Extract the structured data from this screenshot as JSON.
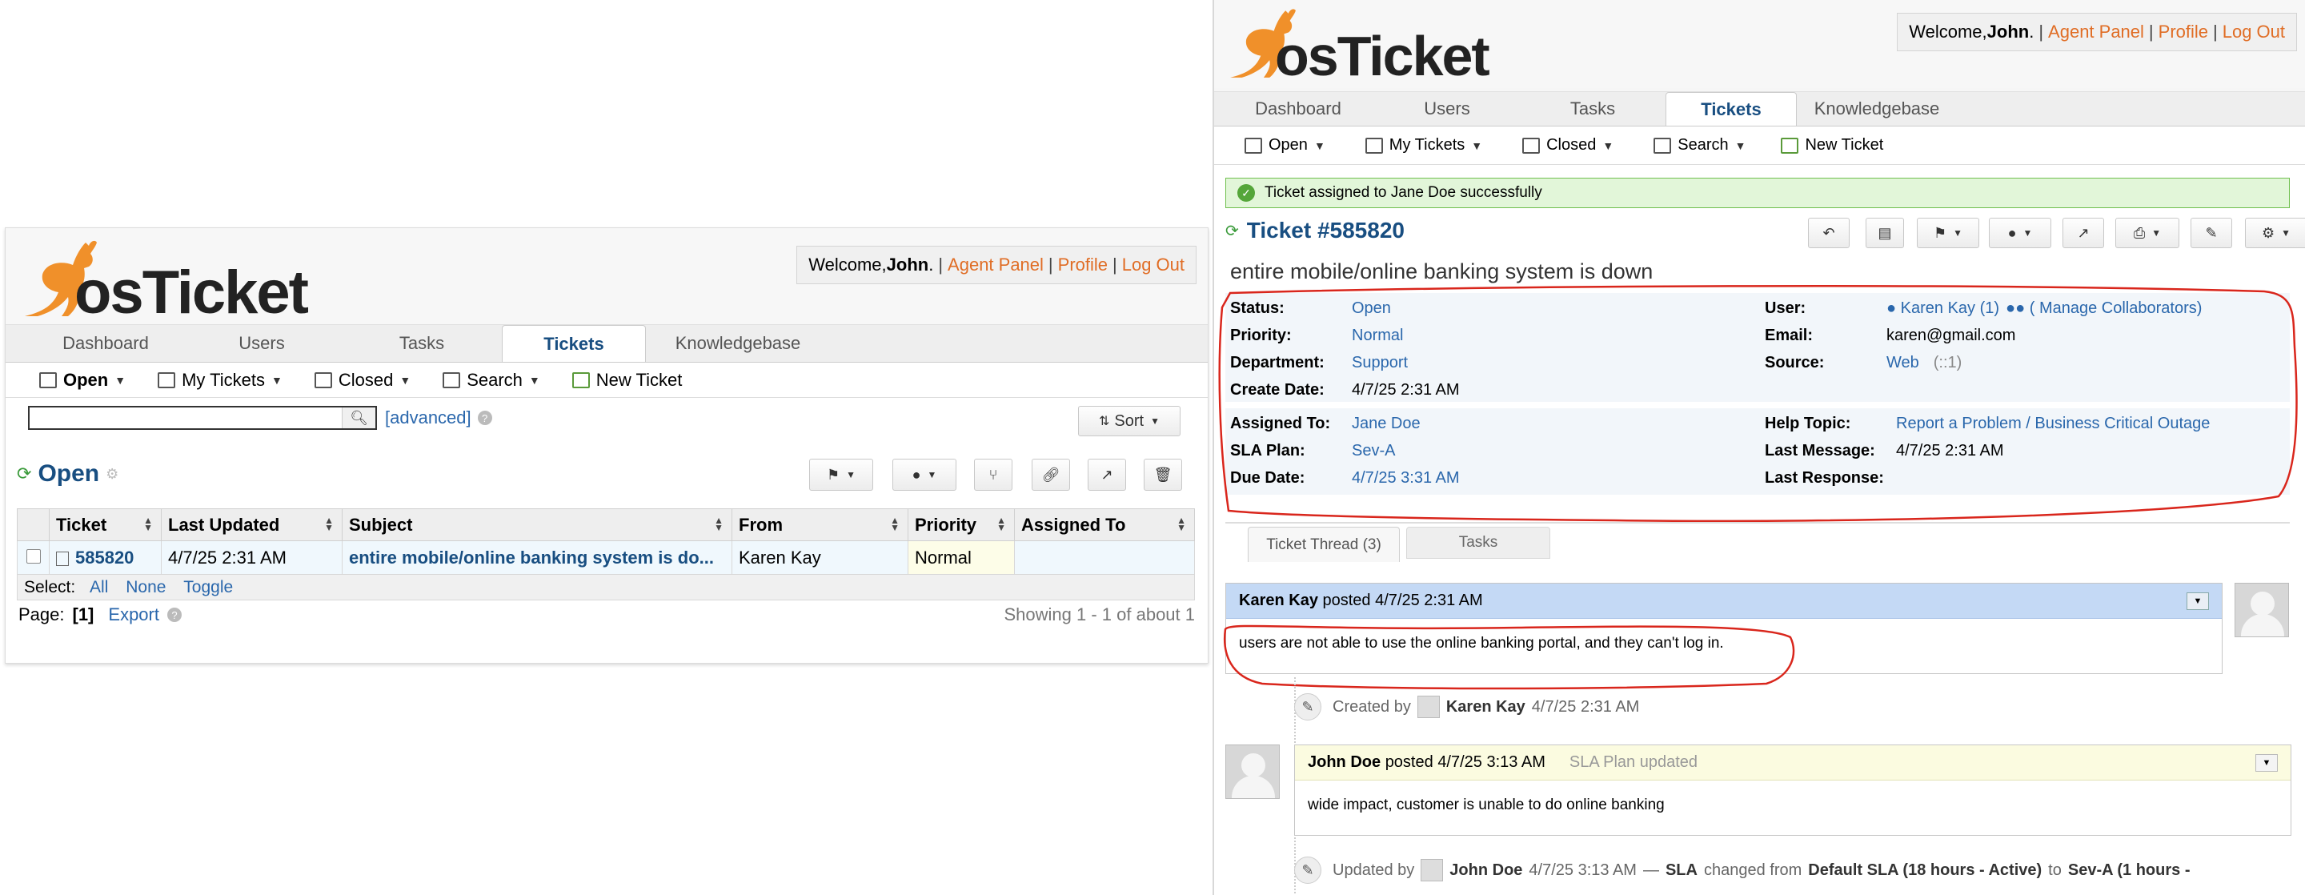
{
  "welcome": {
    "prefix": "Welcome, ",
    "user": "John",
    "suffix": ".",
    "agent_panel": "Agent Panel",
    "profile": "Profile",
    "logout": "Log Out"
  },
  "logo": {
    "text": "osTicket"
  },
  "nav": {
    "tabs": [
      "Dashboard",
      "Users",
      "Tasks",
      "Tickets",
      "Knowledgebase"
    ],
    "active": "Tickets"
  },
  "subnav": {
    "open": "Open",
    "my_tickets": "My Tickets",
    "closed": "Closed",
    "search": "Search",
    "new_ticket": "New Ticket"
  },
  "left": {
    "search_value": "",
    "advanced": "[advanced]",
    "sort": "Sort",
    "queue_title": "Open",
    "columns": [
      "Ticket",
      "Last Updated",
      "Subject",
      "From",
      "Priority",
      "Assigned To"
    ],
    "rows": [
      {
        "ticket": "585820",
        "last_updated": "4/7/25 2:31 AM",
        "subject": "entire mobile/online banking system is do...",
        "from": "Karen Kay",
        "priority": "Normal",
        "assigned_to": ""
      }
    ],
    "select_label": "Select:",
    "select_all": "All",
    "select_none": "None",
    "select_toggle": "Toggle",
    "page_label": "Page:",
    "page_value": "[1]",
    "export": "Export",
    "showing": "Showing 1 - 1 of about 1"
  },
  "right": {
    "alert": "Ticket assigned to Jane Doe successfully",
    "ticket_title": "Ticket #585820",
    "subject": "entire mobile/online banking system is down",
    "info_left_1": [
      {
        "label": "Status:",
        "value": "Open",
        "link": true
      },
      {
        "label": "Priority:",
        "value": "Normal",
        "link": true
      },
      {
        "label": "Department:",
        "value": "Support",
        "link": true
      },
      {
        "label": "Create Date:",
        "value": "4/7/25 2:31 AM",
        "link": false
      }
    ],
    "info_right_1": [
      {
        "label": "User:",
        "value": "Karen Kay (1)",
        "extra": "( Manage Collaborators)"
      },
      {
        "label": "Email:",
        "value": "karen@gmail.com"
      },
      {
        "label": "Source:",
        "value": "Web",
        "extra": "(::1)"
      }
    ],
    "info_left_2": [
      {
        "label": "Assigned To:",
        "value": "Jane Doe",
        "link": true
      },
      {
        "label": "SLA Plan:",
        "value": "Sev-A",
        "link": true
      },
      {
        "label": "Due Date:",
        "value": "4/7/25 3:31 AM",
        "link": true
      }
    ],
    "info_right_2": [
      {
        "label": "Help Topic:",
        "value": "Report a Problem / Business Critical Outage",
        "link": true
      },
      {
        "label": "Last Message:",
        "value": "4/7/25 2:31 AM",
        "link": false
      },
      {
        "label": "Last Response:",
        "value": "",
        "link": false
      }
    ],
    "thread_tabs": [
      "Ticket Thread (3)",
      "Tasks"
    ],
    "entry1": {
      "author": "Karen Kay",
      "posted": "posted",
      "date": "4/7/25 2:31 AM",
      "body": "users are not able to use the online banking portal, and they can't log in."
    },
    "event1": {
      "prefix": "Created by",
      "author": "Karen Kay",
      "date": "4/7/25 2:31 AM"
    },
    "entry2": {
      "author": "John Doe",
      "posted": "posted",
      "date": "4/7/25 3:13 AM",
      "note": "SLA Plan updated",
      "body": "wide impact, customer is unable to do online banking"
    },
    "event2": {
      "prefix": "Updated by",
      "author": "John Doe",
      "date": "4/7/25 3:13 AM",
      "dash": "—",
      "field": "SLA",
      "changed": "changed from",
      "from": "Default SLA (18 hours - Active)",
      "to_word": "to",
      "to": "Sev-A (1 hours -"
    }
  },
  "colors": {
    "accent": "#184e81",
    "link": "#2a67ac",
    "orange": "#e06d25",
    "annotation": "#d9261c",
    "success_bg": "#e2f6d9"
  }
}
